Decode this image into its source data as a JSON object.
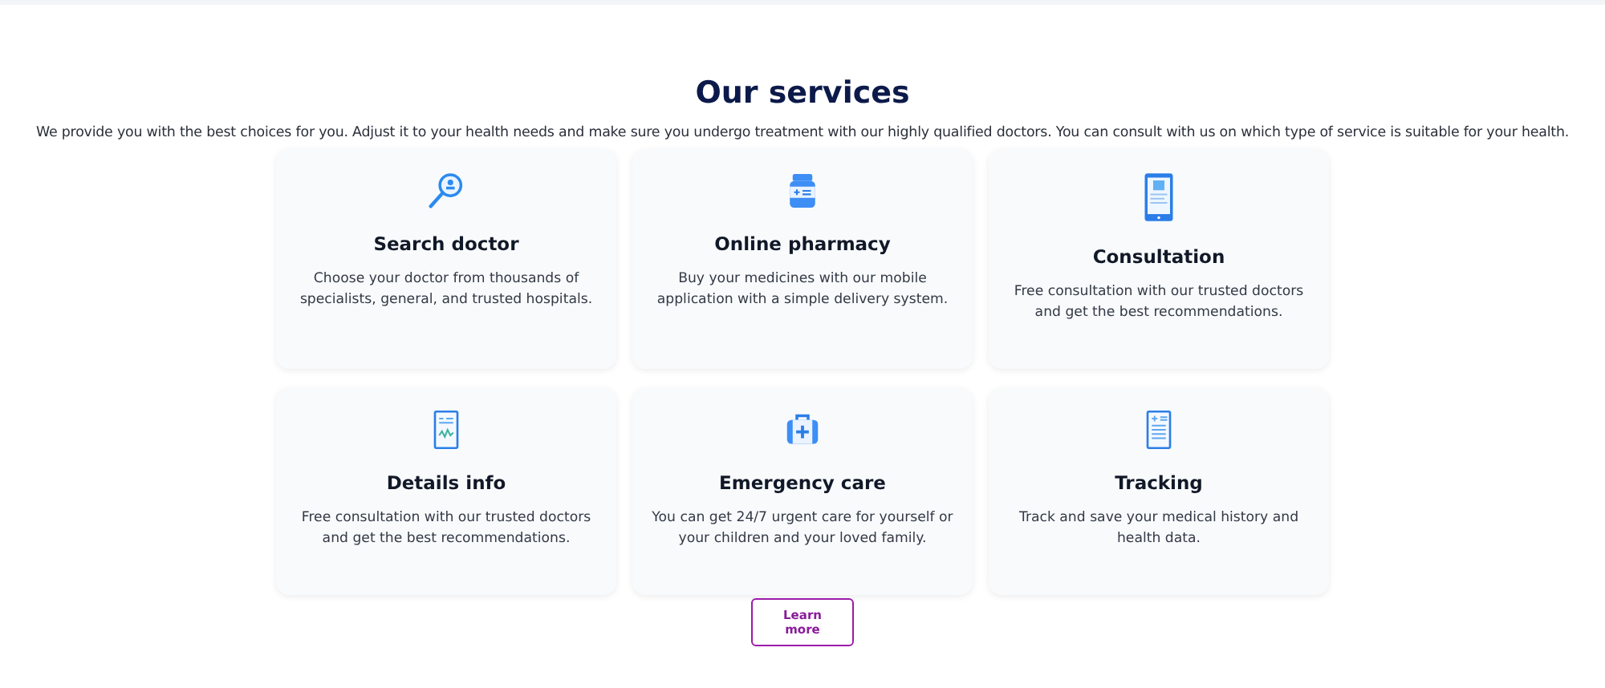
{
  "title": "Our services",
  "intro": "We provide you with the best choices for you. Adjust it to your health needs and make sure you undergo treatment with our highly qualified doctors. You can consult with us on which type of service is suitable for your health.",
  "services": [
    {
      "kind": "search",
      "title": "Search doctor",
      "text": "Choose your doctor from thousands of specialists, general, and trusted hospitals."
    },
    {
      "kind": "pharmacy",
      "title": "Online pharmacy",
      "text": "Buy your medicines with our mobile application with a simple delivery system."
    },
    {
      "kind": "tablet",
      "title": "Consultation",
      "text": "Free consultation with our trusted doctors and get the best recommendations."
    },
    {
      "kind": "chart",
      "title": "Details info",
      "text": "Free consultation with our trusted doctors and get the best recommendations."
    },
    {
      "kind": "kit",
      "title": "Emergency care",
      "text": "You can get 24/7 urgent care for yourself or your children and your loved family."
    },
    {
      "kind": "record",
      "title": "Tracking",
      "text": "Track and save your medical history and health data."
    }
  ],
  "button": "Learn more"
}
